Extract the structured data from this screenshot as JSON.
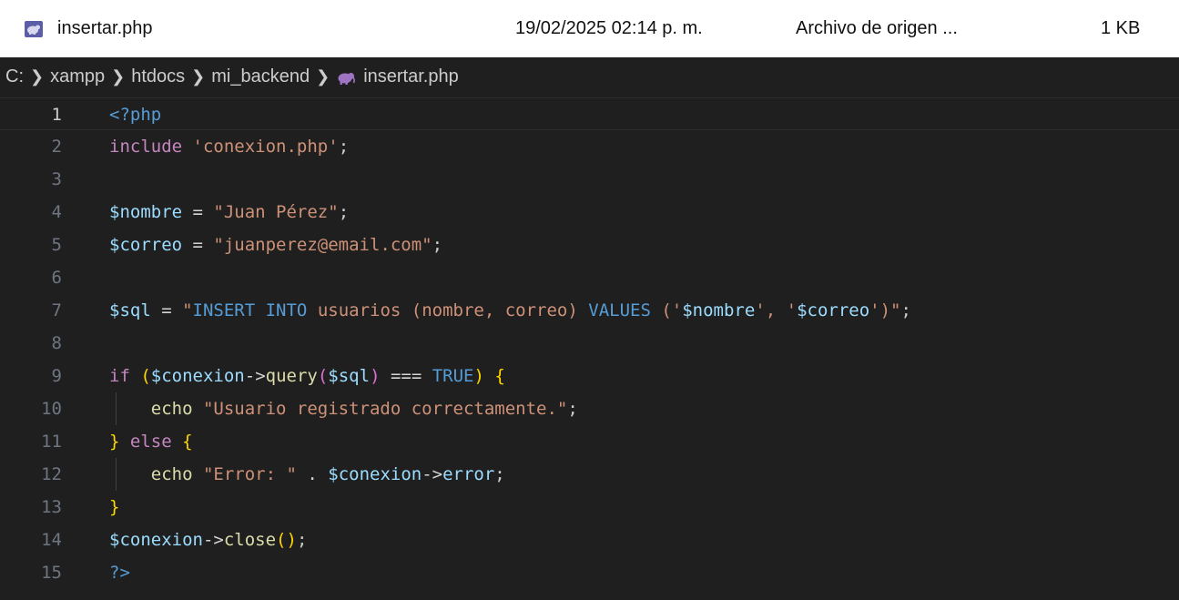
{
  "file_row": {
    "name": "insertar.php",
    "date": "19/02/2025 02:14 p. m.",
    "type": "Archivo de origen ...",
    "size": "1 KB",
    "icon": "php-file-icon"
  },
  "breadcrumb": {
    "items": [
      "C:",
      "xampp",
      "htdocs",
      "mi_backend",
      "insertar.php"
    ],
    "separator": ">",
    "file_icon": "php-elephant-icon"
  },
  "editor": {
    "current_line": 1,
    "colors": {
      "background": "#1f1f1f",
      "keyword": "#c586c0",
      "string": "#ce9178",
      "variable": "#9cdcfe",
      "function": "#dcdcaa",
      "constant": "#569cd6",
      "bracket": "#ffd700",
      "bracket_inner": "#da70d6"
    },
    "lines": [
      {
        "n": "1",
        "tokens": [
          {
            "t": "<?php",
            "c": "tag"
          }
        ]
      },
      {
        "n": "2",
        "tokens": [
          {
            "t": "include",
            "c": "kw"
          },
          {
            "t": " ",
            "c": "plain"
          },
          {
            "t": "'conexion.php'",
            "c": "str"
          },
          {
            "t": ";",
            "c": "plain"
          }
        ]
      },
      {
        "n": "3",
        "tokens": []
      },
      {
        "n": "4",
        "tokens": [
          {
            "t": "$nombre",
            "c": "var"
          },
          {
            "t": " = ",
            "c": "op"
          },
          {
            "t": "\"Juan Pérez\"",
            "c": "str"
          },
          {
            "t": ";",
            "c": "plain"
          }
        ]
      },
      {
        "n": "5",
        "tokens": [
          {
            "t": "$correo",
            "c": "var"
          },
          {
            "t": " = ",
            "c": "op"
          },
          {
            "t": "\"juanperez@email.com\"",
            "c": "str"
          },
          {
            "t": ";",
            "c": "plain"
          }
        ]
      },
      {
        "n": "6",
        "tokens": []
      },
      {
        "n": "7",
        "tokens": [
          {
            "t": "$sql",
            "c": "var"
          },
          {
            "t": " = ",
            "c": "op"
          },
          {
            "t": "\"",
            "c": "str"
          },
          {
            "t": "INSERT INTO",
            "c": "const"
          },
          {
            "t": " usuarios (nombre, correo) ",
            "c": "str"
          },
          {
            "t": "VALUES",
            "c": "const"
          },
          {
            "t": " ('",
            "c": "str"
          },
          {
            "t": "$nombre",
            "c": "var"
          },
          {
            "t": "', '",
            "c": "str"
          },
          {
            "t": "$correo",
            "c": "var"
          },
          {
            "t": "')\"",
            "c": "str"
          },
          {
            "t": ";",
            "c": "plain"
          }
        ]
      },
      {
        "n": "8",
        "tokens": []
      },
      {
        "n": "9",
        "tokens": [
          {
            "t": "if",
            "c": "kw"
          },
          {
            "t": " ",
            "c": "plain"
          },
          {
            "t": "(",
            "c": "b1"
          },
          {
            "t": "$conexion",
            "c": "var"
          },
          {
            "t": "->",
            "c": "op"
          },
          {
            "t": "query",
            "c": "fn"
          },
          {
            "t": "(",
            "c": "b2"
          },
          {
            "t": "$sql",
            "c": "var"
          },
          {
            "t": ")",
            "c": "b2"
          },
          {
            "t": " === ",
            "c": "op"
          },
          {
            "t": "TRUE",
            "c": "const"
          },
          {
            "t": ")",
            "c": "b1"
          },
          {
            "t": " ",
            "c": "plain"
          },
          {
            "t": "{",
            "c": "b1"
          }
        ]
      },
      {
        "n": "10",
        "indent": true,
        "tokens": [
          {
            "t": "    echo",
            "c": "fn"
          },
          {
            "t": " ",
            "c": "plain"
          },
          {
            "t": "\"Usuario registrado correctamente.\"",
            "c": "str"
          },
          {
            "t": ";",
            "c": "plain"
          }
        ]
      },
      {
        "n": "11",
        "tokens": [
          {
            "t": "}",
            "c": "b1"
          },
          {
            "t": " ",
            "c": "plain"
          },
          {
            "t": "else",
            "c": "kw"
          },
          {
            "t": " ",
            "c": "plain"
          },
          {
            "t": "{",
            "c": "b1"
          }
        ]
      },
      {
        "n": "12",
        "indent": true,
        "tokens": [
          {
            "t": "    echo",
            "c": "fn"
          },
          {
            "t": " ",
            "c": "plain"
          },
          {
            "t": "\"Error: \"",
            "c": "str"
          },
          {
            "t": " . ",
            "c": "op"
          },
          {
            "t": "$conexion",
            "c": "var"
          },
          {
            "t": "->",
            "c": "op"
          },
          {
            "t": "error",
            "c": "var"
          },
          {
            "t": ";",
            "c": "plain"
          }
        ]
      },
      {
        "n": "13",
        "tokens": [
          {
            "t": "}",
            "c": "b1"
          }
        ]
      },
      {
        "n": "14",
        "tokens": [
          {
            "t": "$conexion",
            "c": "var"
          },
          {
            "t": "->",
            "c": "op"
          },
          {
            "t": "close",
            "c": "fn"
          },
          {
            "t": "(",
            "c": "b1"
          },
          {
            "t": ")",
            "c": "b1"
          },
          {
            "t": ";",
            "c": "plain"
          }
        ]
      },
      {
        "n": "15",
        "tokens": [
          {
            "t": "?>",
            "c": "tag"
          }
        ]
      }
    ]
  }
}
